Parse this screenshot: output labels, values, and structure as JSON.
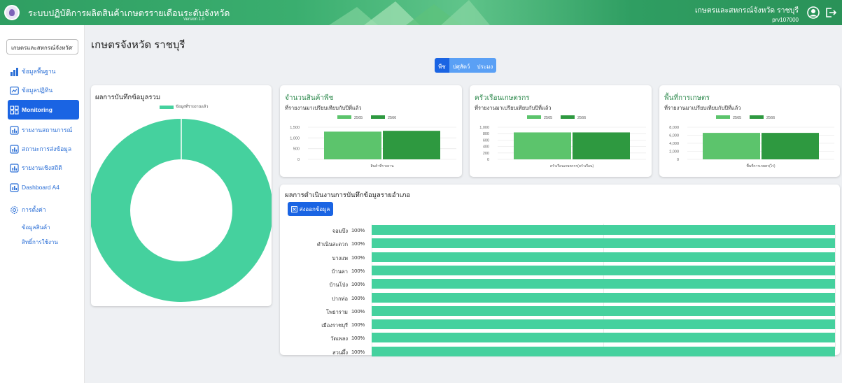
{
  "header": {
    "title": "ระบบปฏิบัติการผลิตสินค้าเกษตรรายเดือนระดับจังหวัด",
    "version": "Version 1.0",
    "user_name": "เกษตรและสหกรณ์จังหวัด ราชบุรี",
    "user_code": "prv107000",
    "icons": [
      "user-circle-icon",
      "logout-icon"
    ]
  },
  "sidebar": {
    "province_select": "เกษตรและสหกรณ์จังหวัด",
    "items": [
      {
        "label": "ข้อมูลพื้นฐาน",
        "icon": "bar-chart-icon"
      },
      {
        "label": "ข้อมูลปฏิทิน",
        "icon": "calendar-chart-icon"
      },
      {
        "label": "Monitoring",
        "icon": "grid-icon",
        "active": true
      },
      {
        "label": "รายงานสถานการณ์",
        "icon": "report-icon"
      },
      {
        "label": "สถานะการส่งข้อมูล",
        "icon": "report-icon"
      },
      {
        "label": "รายงานเชิงสถิติ",
        "icon": "report-icon"
      },
      {
        "label": "Dashboard A4",
        "icon": "report-icon"
      },
      {
        "label": "การตั้งค่า",
        "icon": "gear-icon"
      }
    ],
    "sub_items": [
      "ข้อมูลสินค้า",
      "สิทธิ์การใช้งาน"
    ]
  },
  "main": {
    "page_title": "เกษตรจังหวัด ราชบุรี",
    "segments": [
      {
        "label": "พืช",
        "active": true
      },
      {
        "label": "ปศุสัตว์",
        "active": false
      },
      {
        "label": "ประมง",
        "active": false
      }
    ],
    "summary_card": {
      "title": "ผลการบันทึกข้อมูลรวม",
      "legend": "ข้อมูลที่รายงานแล้ว"
    },
    "cards": [
      {
        "title": "จำนวนสินค้าพืช",
        "subtitle": "ที่รายงานมาเปรียบเทียบกับปีที่แล้ว",
        "xlabel": "สินค้าที่รายงาน"
      },
      {
        "title": "ครัวเรือนเกษตรกร",
        "subtitle": "ที่รายงานมาเปรียบเทียบกับปีที่แล้ว",
        "xlabel": "ครัวเรือนเกษตรกร(ครัวเรือน)"
      },
      {
        "title": "พื้นที่การเกษตร",
        "subtitle": "ที่รายงานมาเปรียบเทียบกับปีที่แล้ว",
        "xlabel": "พื้นที่การเกษตร(ไร่)"
      }
    ],
    "district_card": {
      "title": "ผลการดำเนินงานการบันทึกข้อมูลรายอำเภอ",
      "export_label": "ส่งออกข้อมูล"
    }
  },
  "colors": {
    "prev_year": "#5cc46c",
    "curr_year": "#2e9940",
    "accent": "#1a64e3",
    "donut": "#45d19e"
  },
  "chart_data": [
    {
      "type": "pie",
      "title": "ผลการบันทึกข้อมูลรวม",
      "categories": [
        "ข้อมูลที่รายงานแล้ว"
      ],
      "values": [
        100
      ],
      "donut": true,
      "legend": "top"
    },
    {
      "type": "bar",
      "title": "จำนวนสินค้าพืช",
      "categories": [
        "สินค้าที่รายงาน"
      ],
      "series": [
        {
          "name": "2565",
          "values": [
            1380
          ]
        },
        {
          "name": "2566",
          "values": [
            1420
          ]
        }
      ],
      "yticks": [
        "1,500",
        "1,000",
        "500",
        "0"
      ],
      "ylim": [
        0,
        1600
      ]
    },
    {
      "type": "bar",
      "title": "ครัวเรือนเกษตรกร",
      "categories": [
        "ครัวเรือนเกษตรกร(ครัวเรือน)"
      ],
      "series": [
        {
          "name": "2565",
          "values": [
            880
          ]
        },
        {
          "name": "2566",
          "values": [
            880
          ]
        }
      ],
      "yticks": [
        "1,000",
        "800",
        "600",
        "400",
        "200",
        "0"
      ],
      "ylim": [
        0,
        1050
      ]
    },
    {
      "type": "bar",
      "title": "พื้นที่การเกษตร",
      "categories": [
        "พื้นที่การเกษตร(ไร่)"
      ],
      "series": [
        {
          "name": "2565",
          "values": [
            7000
          ]
        },
        {
          "name": "2566",
          "values": [
            7000
          ]
        }
      ],
      "yticks": [
        "8,000",
        "6,000",
        "4,000",
        "2,000",
        "0"
      ],
      "ylim": [
        0,
        8500
      ]
    },
    {
      "type": "bar",
      "title": "ผลการดำเนินงานการบันทึกข้อมูลรายอำเภอ",
      "orientation": "horizontal",
      "categories": [
        "จอมบึง",
        "ดำเนินสะดวก",
        "บางแพ",
        "บ้านคา",
        "บ้านโป่ง",
        "ปากท่อ",
        "โพธาราม",
        "เมืองราชบุรี",
        "วัดเพลง",
        "สวนผึ้ง"
      ],
      "values": [
        100,
        100,
        100,
        100,
        100,
        100,
        100,
        100,
        100,
        100
      ],
      "labels": [
        "100%",
        "100%",
        "100%",
        "100%",
        "100%",
        "100%",
        "100%",
        "100%",
        "100%",
        "100%"
      ],
      "xlim": [
        0,
        100
      ]
    }
  ]
}
